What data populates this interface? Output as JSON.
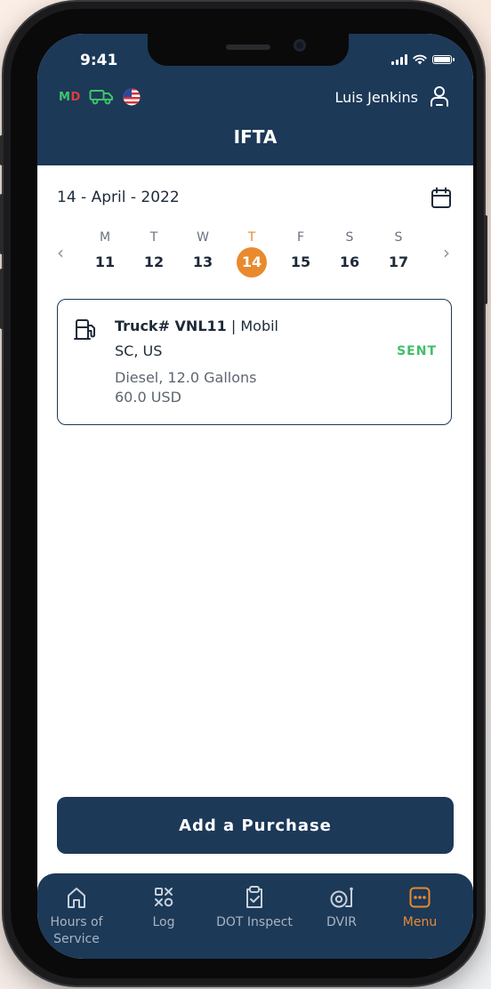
{
  "status_bar": {
    "time": "9:41"
  },
  "header": {
    "badge_m": "M",
    "badge_d": "D",
    "user_name": "Luis Jenkins",
    "title": "IFTA"
  },
  "date": {
    "text": "14 - April - 2022"
  },
  "week": {
    "days": [
      {
        "dow": "M",
        "num": "11"
      },
      {
        "dow": "T",
        "num": "12"
      },
      {
        "dow": "W",
        "num": "13"
      },
      {
        "dow": "T",
        "num": "14"
      },
      {
        "dow": "F",
        "num": "15"
      },
      {
        "dow": "S",
        "num": "16"
      },
      {
        "dow": "S",
        "num": "17"
      }
    ],
    "selected_index": 3
  },
  "purchase": {
    "truck": "Truck# VNL11",
    "separator": " | ",
    "vendor": "Mobil",
    "location": "SC, US",
    "status": "SENT",
    "fuel": "Diesel, 12.0 Gallons",
    "amount": "60.0 USD"
  },
  "add_button": {
    "label": "Add a Purchase"
  },
  "tabs": [
    {
      "label": "Hours of Service",
      "icon": "home-icon"
    },
    {
      "label": "Log",
      "icon": "log-icon"
    },
    {
      "label": "DOT Inspect",
      "icon": "clipboard-check-icon"
    },
    {
      "label": "DVIR",
      "icon": "tire-icon"
    },
    {
      "label": "Menu",
      "icon": "menu-dots-icon"
    }
  ],
  "colors": {
    "primary": "#1c3958",
    "accent": "#e98a2e",
    "status_sent": "#3fbf6a",
    "badge_green": "#3fc46b",
    "badge_red": "#e03b3b"
  }
}
